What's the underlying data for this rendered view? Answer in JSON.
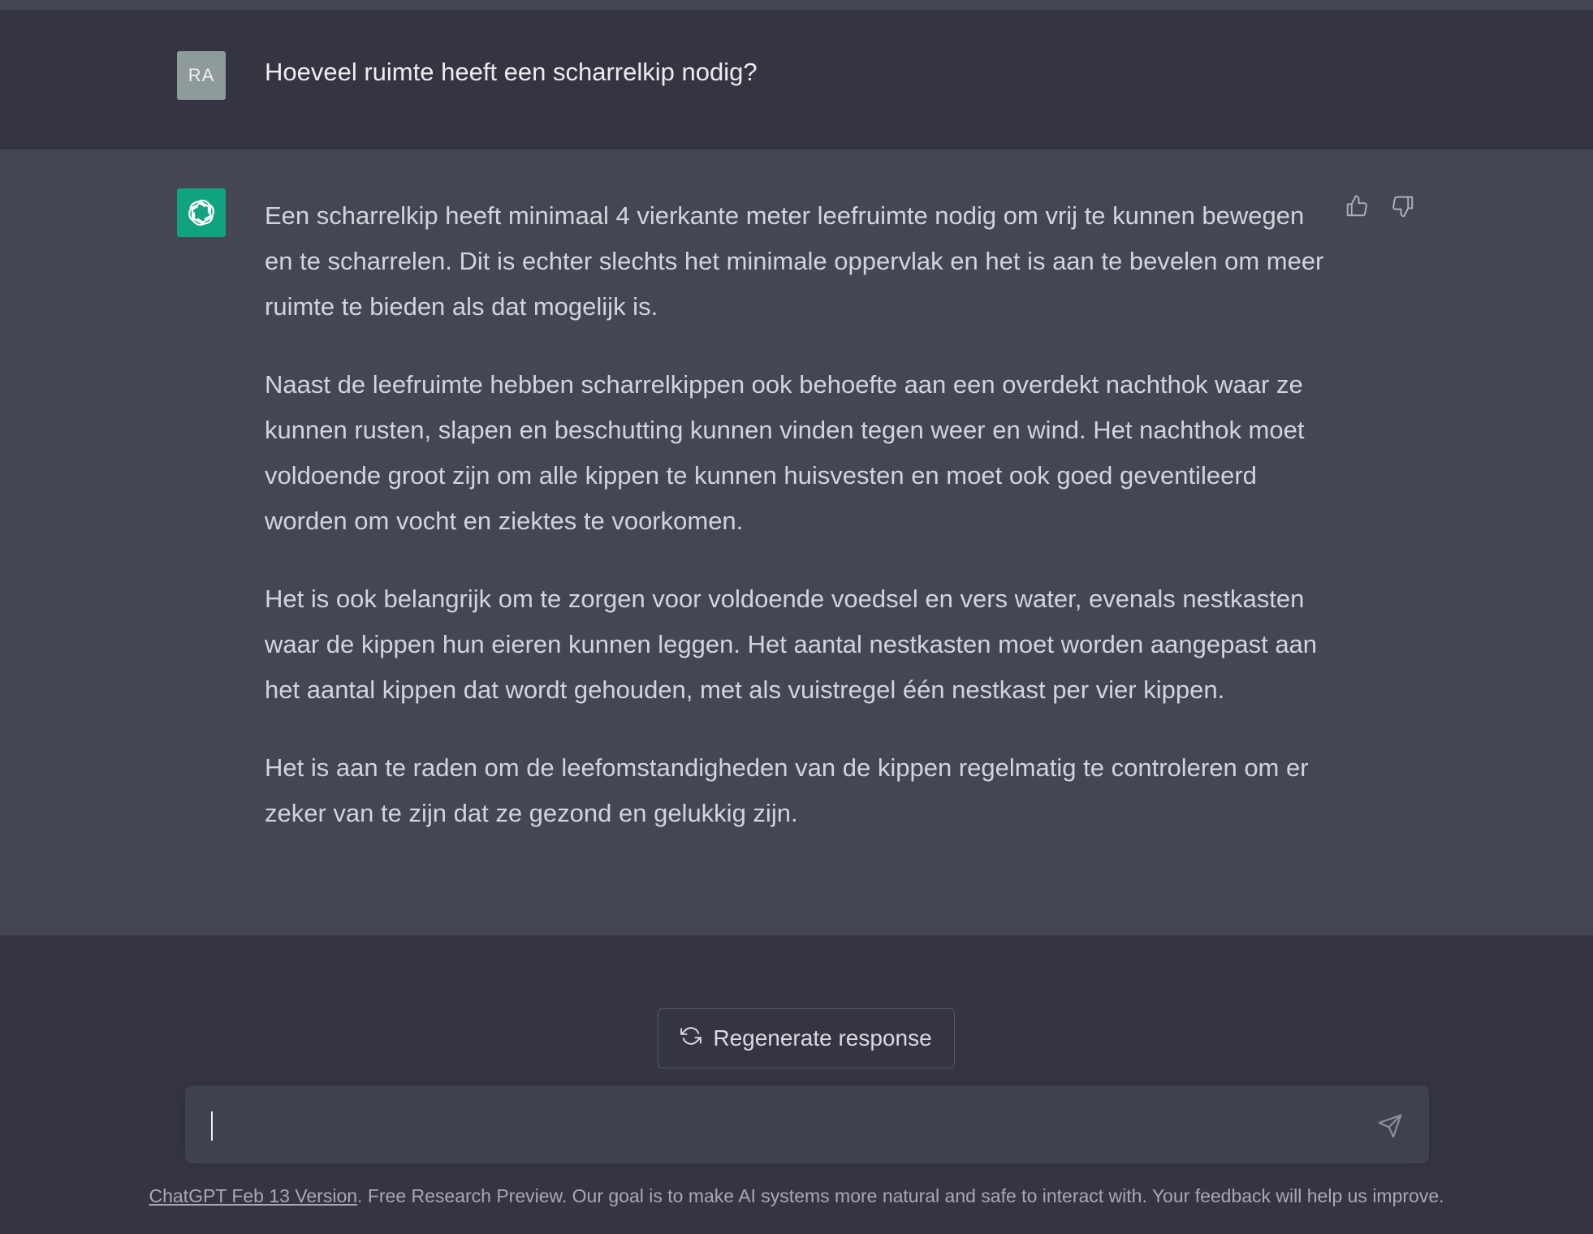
{
  "user_message": {
    "avatar_initials": "RA",
    "text": "Hoeveel ruimte heeft een scharrelkip nodig?"
  },
  "assistant_message": {
    "avatar_icon": "openai-logo-icon",
    "paragraphs": [
      "Een scharrelkip heeft minimaal 4 vierkante meter leefruimte nodig om vrij te kunnen bewegen en te scharrelen. Dit is echter slechts het minimale oppervlak en het is aan te bevelen om meer ruimte te bieden als dat mogelijk is.",
      "Naast de leefruimte hebben scharrelkippen ook behoefte aan een overdekt nachthok waar ze kunnen rusten, slapen en beschutting kunnen vinden tegen weer en wind. Het nachthok moet voldoende groot zijn om alle kippen te kunnen huisvesten en moet ook goed geventileerd worden om vocht en ziektes te voorkomen.",
      "Het is ook belangrijk om te zorgen voor voldoende voedsel en vers water, evenals nestkasten waar de kippen hun eieren kunnen leggen. Het aantal nestkasten moet worden aangepast aan het aantal kippen dat wordt gehouden, met als vuistregel één nestkast per vier kippen.",
      "Het is aan te raden om de leefomstandigheden van de kippen regelmatig te controleren om er zeker van te zijn dat ze gezond en gelukkig zijn."
    ],
    "feedback_icons": [
      "thumbs-up-icon",
      "thumbs-down-icon"
    ]
  },
  "regenerate": {
    "label": "Regenerate response",
    "icon": "refresh-icon"
  },
  "composer": {
    "value": "",
    "send_icon": "send-icon"
  },
  "footer": {
    "link_text": "ChatGPT Feb 13 Version",
    "text": ". Free Research Preview. Our goal is to make AI systems more natural and safe to interact with. Your feedback will help us improve."
  },
  "colors": {
    "page_bg": "#343541",
    "assistant_bg": "#444654",
    "bot_avatar": "#10a37f",
    "user_avatar": "#8e9a9c",
    "input_bg": "#40414f"
  }
}
